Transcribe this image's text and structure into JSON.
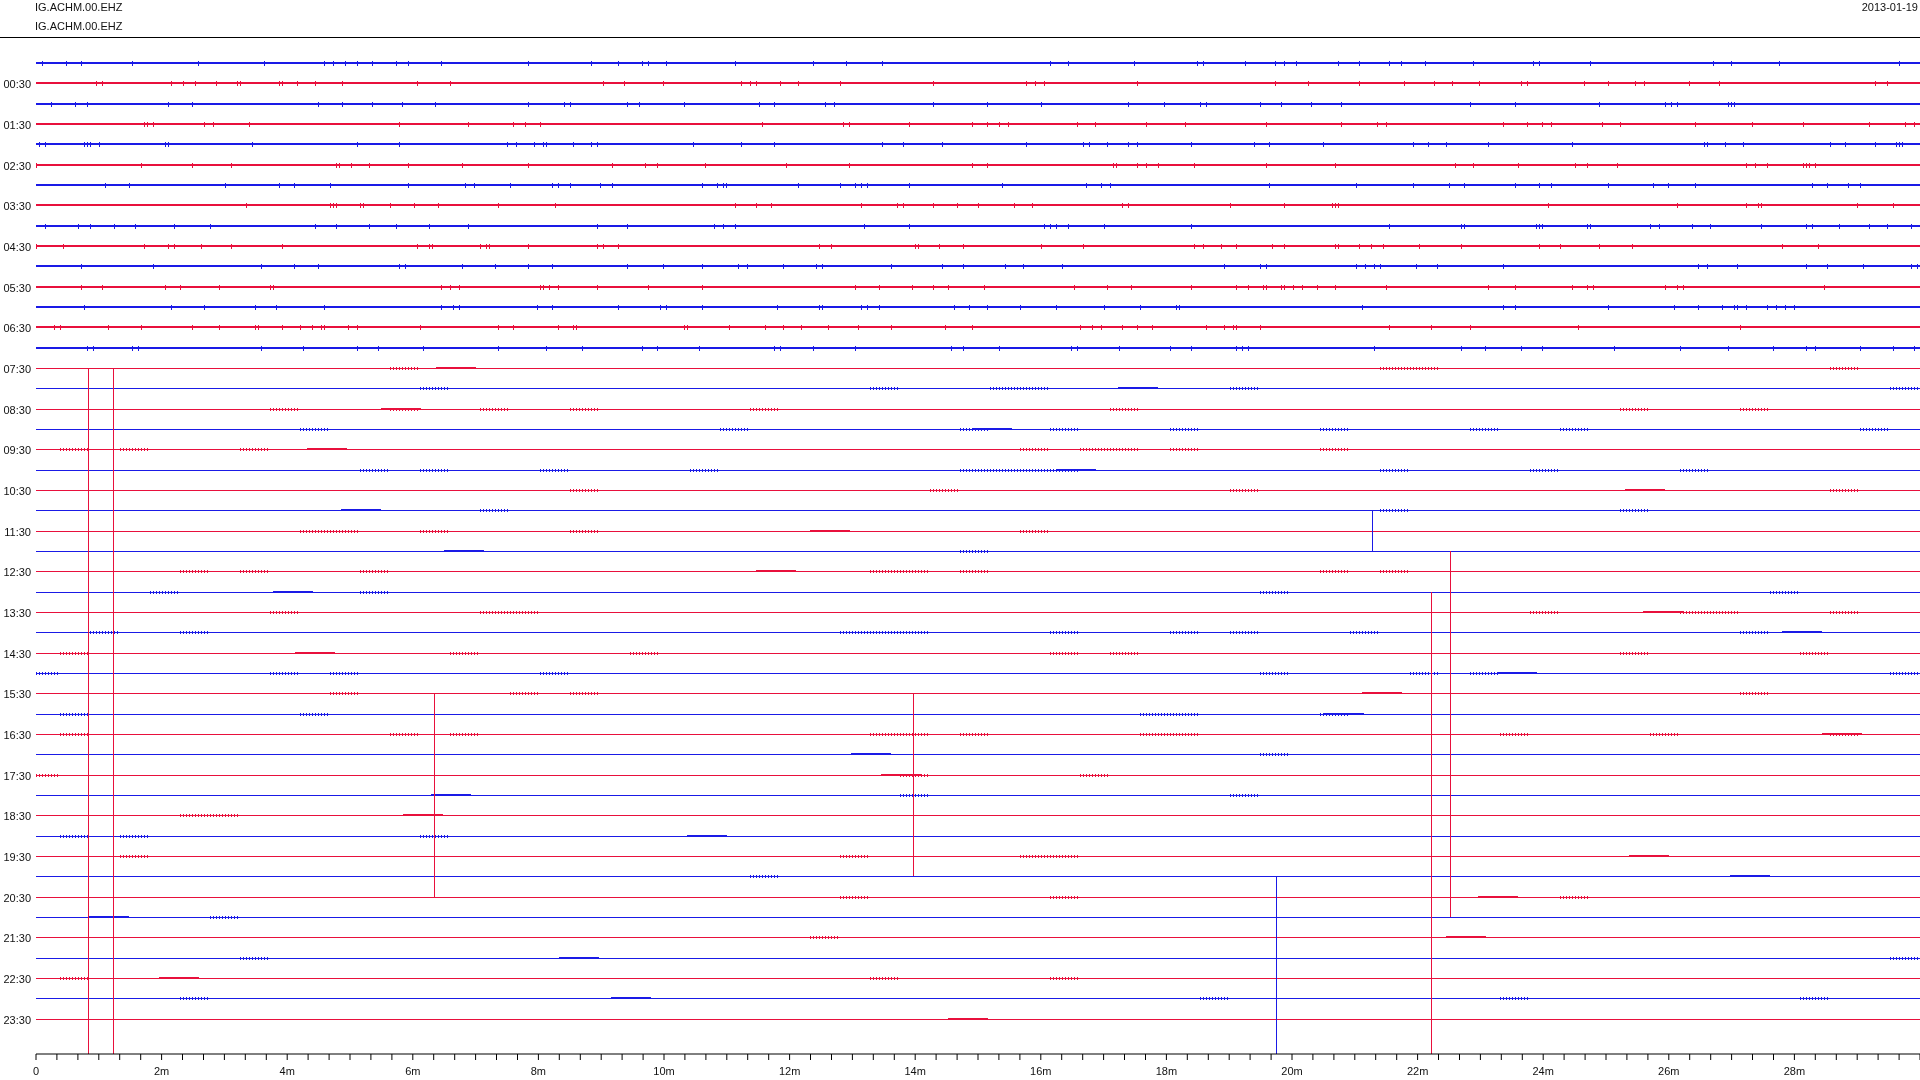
{
  "header": {
    "channel_lines": [
      "IG.ACHM.00.EHZ",
      "IG.ACHM.00.EHZ"
    ],
    "date": "2013-01-19"
  },
  "traces": [
    {
      "color": "#1a1ae6"
    },
    {
      "color": "#e8103c",
      "time": "00:30"
    },
    {
      "color": "#1a1ae6"
    },
    {
      "color": "#e8103c",
      "time": "01:30"
    },
    {
      "color": "#1a1ae6"
    },
    {
      "color": "#e8103c",
      "time": "02:30"
    },
    {
      "color": "#1a1ae6"
    },
    {
      "color": "#e8103c",
      "time": "03:30"
    },
    {
      "color": "#1a1ae6"
    },
    {
      "color": "#e8103c",
      "time": "04:30"
    },
    {
      "color": "#1a1ae6"
    },
    {
      "color": "#e8103c",
      "time": "05:30"
    },
    {
      "color": "#1a1ae6"
    },
    {
      "color": "#e8103c",
      "time": "06:30"
    },
    {
      "color": "#1a1ae6"
    },
    {
      "color": "#e8103c",
      "time": "07:30"
    },
    {
      "color": "#1a1ae6"
    },
    {
      "color": "#e8103c",
      "time": "08:30"
    },
    {
      "color": "#1a1ae6"
    },
    {
      "color": "#e8103c",
      "time": "09:30"
    },
    {
      "color": "#1a1ae6"
    },
    {
      "color": "#e8103c",
      "time": "10:30"
    },
    {
      "color": "#1a1ae6"
    },
    {
      "color": "#e8103c",
      "time": "11:30"
    },
    {
      "color": "#1a1ae6"
    },
    {
      "color": "#e8103c",
      "time": "12:30"
    },
    {
      "color": "#1a1ae6"
    },
    {
      "color": "#e8103c",
      "time": "13:30"
    },
    {
      "color": "#1a1ae6"
    },
    {
      "color": "#e8103c",
      "time": "14:30"
    },
    {
      "color": "#1a1ae6"
    },
    {
      "color": "#e8103c",
      "time": "15:30"
    },
    {
      "color": "#1a1ae6"
    },
    {
      "color": "#e8103c",
      "time": "16:30"
    },
    {
      "color": "#1a1ae6"
    },
    {
      "color": "#e8103c",
      "time": "17:30"
    },
    {
      "color": "#1a1ae6"
    },
    {
      "color": "#e8103c",
      "time": "18:30"
    },
    {
      "color": "#1a1ae6"
    },
    {
      "color": "#e8103c",
      "time": "19:30"
    },
    {
      "color": "#1a1ae6"
    },
    {
      "color": "#e8103c",
      "time": "20:30"
    },
    {
      "color": "#1a1ae6"
    },
    {
      "color": "#e8103c",
      "time": "21:30"
    },
    {
      "color": "#1a1ae6"
    },
    {
      "color": "#e8103c",
      "time": "22:30"
    },
    {
      "color": "#1a1ae6"
    },
    {
      "color": "#e8103c",
      "time": "23:30"
    }
  ],
  "x_axis": {
    "tick_labels": [
      "0",
      "2m",
      "4m",
      "6m",
      "8m",
      "10m",
      "12m",
      "14m",
      "16m",
      "18m",
      "20m",
      "22m",
      "24m",
      "26m",
      "28m"
    ]
  }
}
